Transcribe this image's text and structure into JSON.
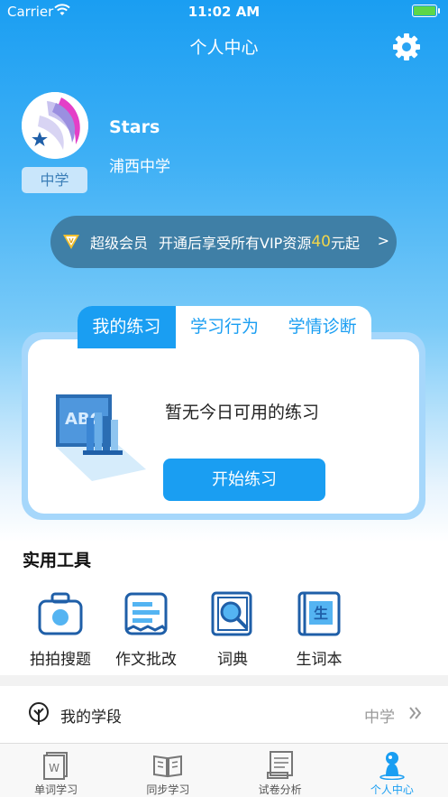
{
  "status_bar": {
    "carrier": "Carrier",
    "time": "11:02 AM"
  },
  "nav": {
    "title": "个人中心",
    "settings_icon": "gear-icon"
  },
  "profile": {
    "name": "Stars",
    "school": "浦西中学",
    "grade": "中学"
  },
  "vip": {
    "level": "超级会员",
    "desc": "开通后享受所有VIP资源",
    "price": "40",
    "price_suffix": "元起",
    "chevron": ">"
  },
  "practice": {
    "tabs": [
      {
        "label": "我的练习",
        "active": true
      },
      {
        "label": "学习行为",
        "active": false
      },
      {
        "label": "学情诊断",
        "active": false
      }
    ],
    "empty_text": "暂无今日可用的练习",
    "start_button": "开始练习"
  },
  "tools": {
    "title": "实用工具",
    "items": [
      {
        "label": "拍拍搜题",
        "icon": "camera-icon"
      },
      {
        "label": "作文批改",
        "icon": "document-icon"
      },
      {
        "label": "词典",
        "icon": "dictionary-search-icon"
      },
      {
        "label": "生词本",
        "icon": "vocab-book-icon"
      }
    ]
  },
  "stage": {
    "label": "我的学段",
    "value": "中学"
  },
  "tabbar": [
    {
      "label": "单词学习",
      "icon": "word-card-icon",
      "active": false
    },
    {
      "label": "同步学习",
      "icon": "open-book-icon",
      "active": false
    },
    {
      "label": "试卷分析",
      "icon": "exam-paper-icon",
      "active": false
    },
    {
      "label": "个人中心",
      "icon": "person-icon",
      "active": true
    }
  ],
  "colors": {
    "primary": "#1a9ef2",
    "vip_price": "#f2d64a",
    "vip_bg": "#3f7fa6"
  }
}
